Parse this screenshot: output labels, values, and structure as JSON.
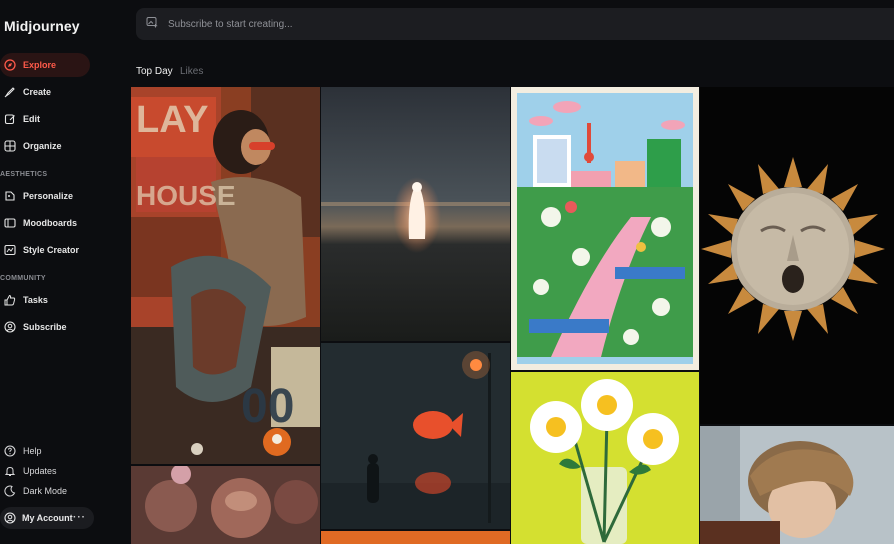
{
  "app": {
    "title": "Midjourney"
  },
  "nav": {
    "explore": "Explore",
    "create": "Create",
    "edit": "Edit",
    "organize": "Organize",
    "aesthetics_label": "AESTHETICS",
    "personalize": "Personalize",
    "moodboards": "Moodboards",
    "style_creator": "Style Creator",
    "community_label": "COMMUNITY",
    "tasks": "Tasks",
    "subscribe": "Subscribe"
  },
  "bottom_nav": {
    "help": "Help",
    "updates": "Updates",
    "dark_mode": "Dark Mode",
    "my_account": "My Account",
    "more": "···"
  },
  "search": {
    "placeholder": "Subscribe to start creating..."
  },
  "tabs": {
    "top_day": "Top Day",
    "likes": "Likes"
  },
  "colors": {
    "accent": "#ff5a4a",
    "background": "#0c0d10",
    "panel": "#1c1d21"
  },
  "icons": [
    "explore-compass-icon",
    "create-brush-icon",
    "edit-icon",
    "organize-grid-icon",
    "personalize-icon",
    "moodboards-icon",
    "style-creator-icon",
    "tasks-thumbs-up-icon",
    "subscribe-user-icon",
    "help-icon",
    "updates-bell-icon",
    "dark-mode-moon-icon",
    "account-avatar-icon",
    "image-add-icon"
  ]
}
